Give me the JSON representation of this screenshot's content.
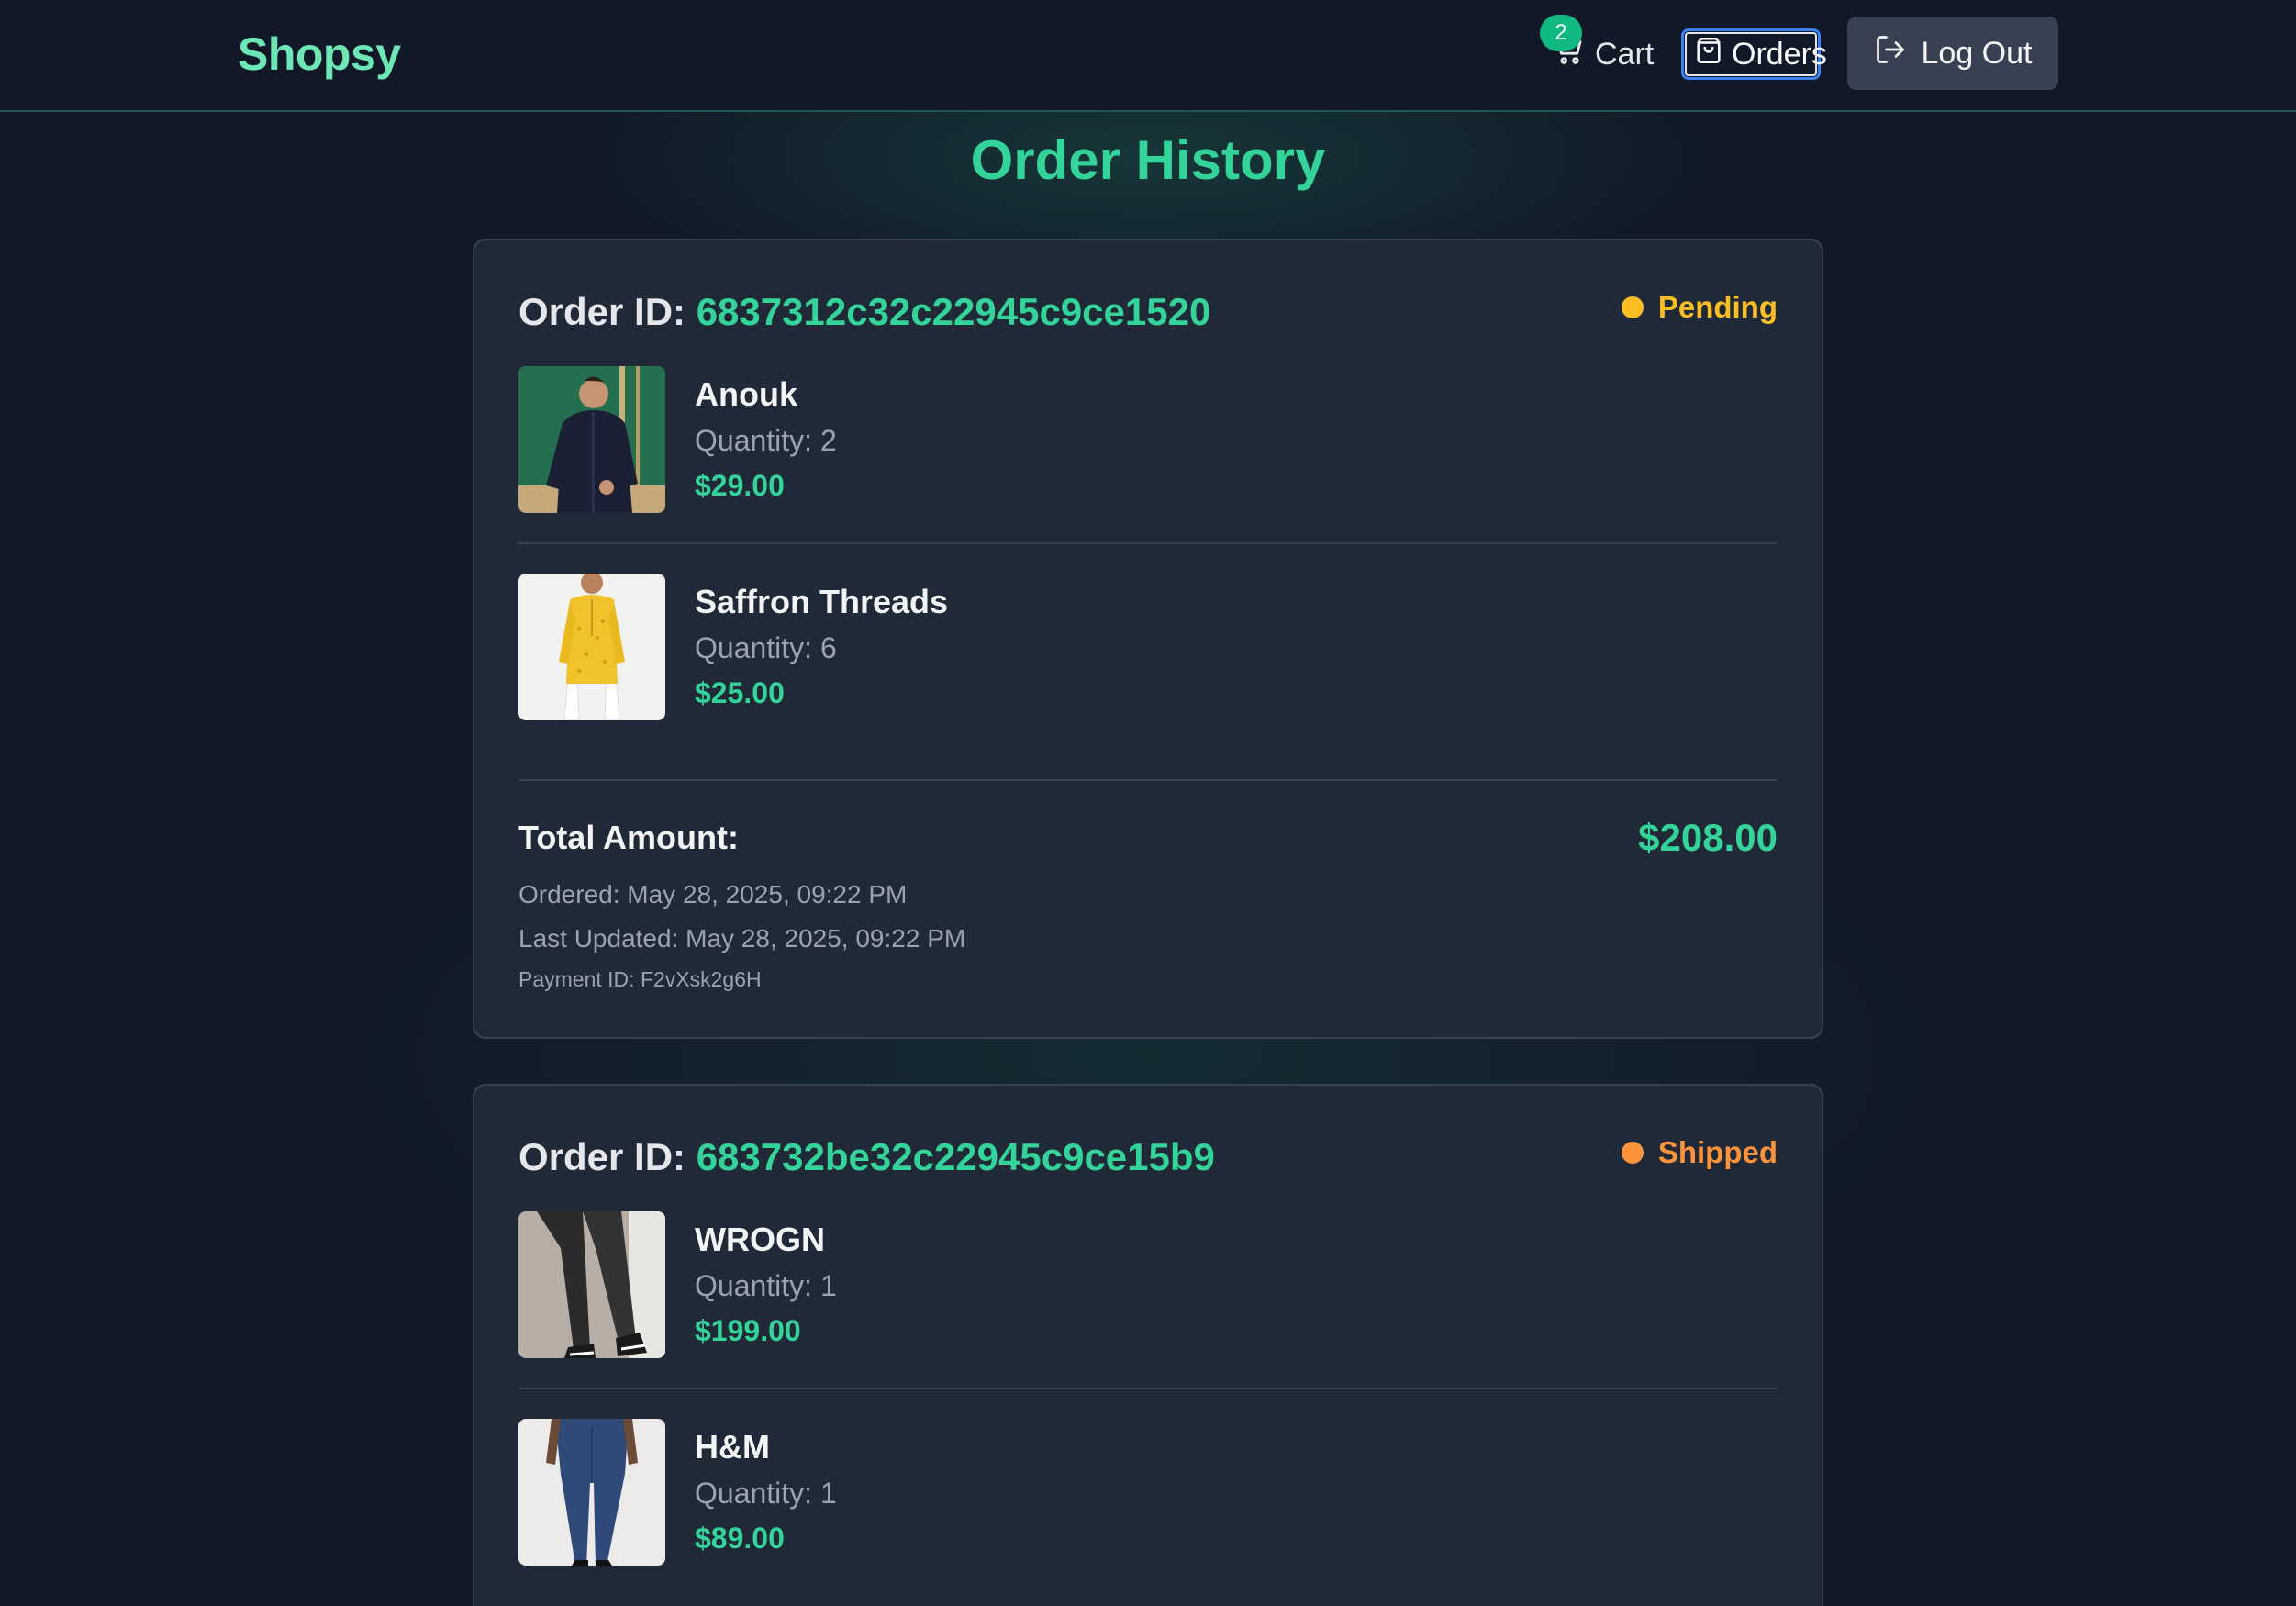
{
  "app": {
    "brand": "Shopsy",
    "accent": "#34d399",
    "background": "#111827",
    "card_background": "#1f2937"
  },
  "nav": {
    "cart_label": "Cart",
    "cart_count": "2",
    "orders_label": "Orders",
    "logout_label": "Log Out"
  },
  "page": {
    "title": "Order History"
  },
  "orders": [
    {
      "id_label": "Order ID:",
      "id": "6837312c32c22945c9ce1520",
      "status": "Pending",
      "status_color": "#fbbf24",
      "items": [
        {
          "name": "Anouk",
          "quantity": "Quantity: 2",
          "price": "$29.00",
          "image": "man in dark navy shirt"
        },
        {
          "name": "Saffron Threads",
          "quantity": "Quantity: 6",
          "price": "$25.00",
          "image": "yellow kurta"
        }
      ],
      "total_label": "Total Amount:",
      "total": "$208.00",
      "ordered_label": "Ordered:",
      "ordered": "May 28, 2025, 09:22 PM",
      "updated_label": "Last Updated:",
      "updated": "May 28, 2025, 09:22 PM",
      "payment_label": "Payment ID:",
      "payment_id": "F2vXsk2g6H"
    },
    {
      "id_label": "Order ID:",
      "id": "683732be32c22945c9ce15b9",
      "status": "Shipped",
      "status_color": "#fb923c",
      "items": [
        {
          "name": "WROGN",
          "quantity": "Quantity: 1",
          "price": "$199.00",
          "image": "dark jeans with sneakers"
        },
        {
          "name": "H&M",
          "quantity": "Quantity: 1",
          "price": "$89.00",
          "image": "blue jeans"
        }
      ]
    }
  ]
}
